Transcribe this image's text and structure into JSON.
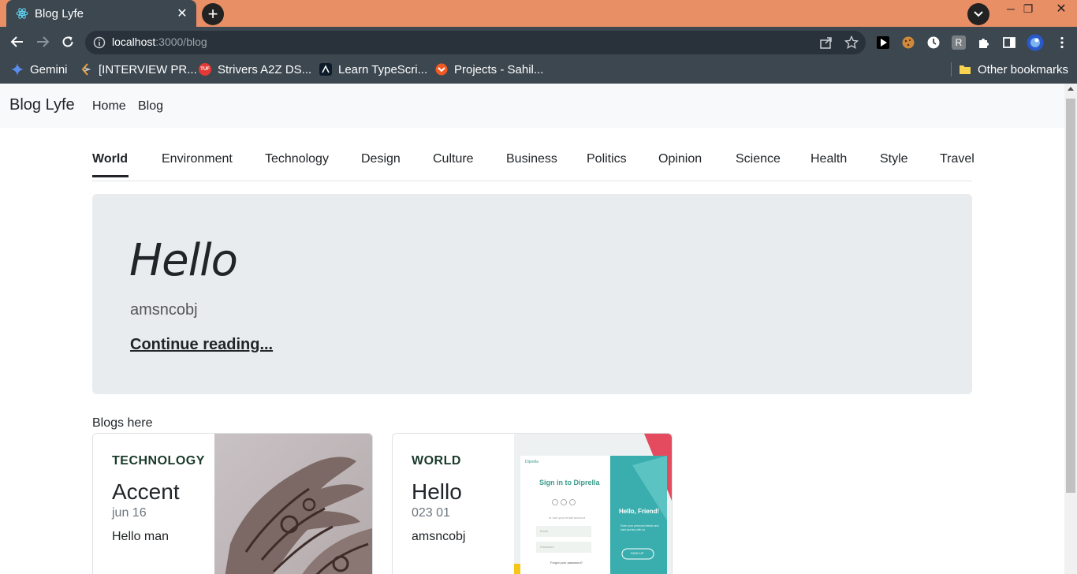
{
  "browser": {
    "tab_title": "Blog Lyfe",
    "url_host": "localhost",
    "url_rest": ":3000/blog",
    "bookmarks": [
      {
        "label": "Gemini"
      },
      {
        "label": "[INTERVIEW PR..."
      },
      {
        "label": "Strivers A2Z DS..."
      },
      {
        "label": "Learn TypeScri..."
      },
      {
        "label": "Projects - Sahil..."
      }
    ],
    "other_bookmarks": "Other bookmarks",
    "bookmark_icon_texts": {
      "tuf": "TUF",
      "ext_r": "R"
    }
  },
  "site": {
    "brand": "Blog Lyfe",
    "nav": [
      "Home",
      "Blog"
    ],
    "categories": [
      "World",
      "Environment",
      "Technology",
      "Design",
      "Culture",
      "Business",
      "Politics",
      "Opinion",
      "Science",
      "Health",
      "Style",
      "Travel"
    ],
    "active_category": "World"
  },
  "hero": {
    "title": "Hello",
    "description": "amsncobj",
    "link": "Continue reading..."
  },
  "blogs_label": "Blogs here",
  "cards": [
    {
      "category": "TECHNOLOGY",
      "title": "Accent",
      "date": "jun 16",
      "text": "Hello man"
    },
    {
      "category": "WORLD",
      "title": "Hello",
      "date": "023 01",
      "text": "amsncobj"
    }
  ],
  "thumb2": {
    "logo": "Diprella",
    "heading": "Sign in to Diprella",
    "sub": "or use your email account",
    "email": "Email",
    "password": "Password",
    "forgot": "Forgot your password?",
    "hello": "Hello, Friend!",
    "hello_sub": "Enter your personal details and start journey with us",
    "signup": "SIGN UP"
  }
}
